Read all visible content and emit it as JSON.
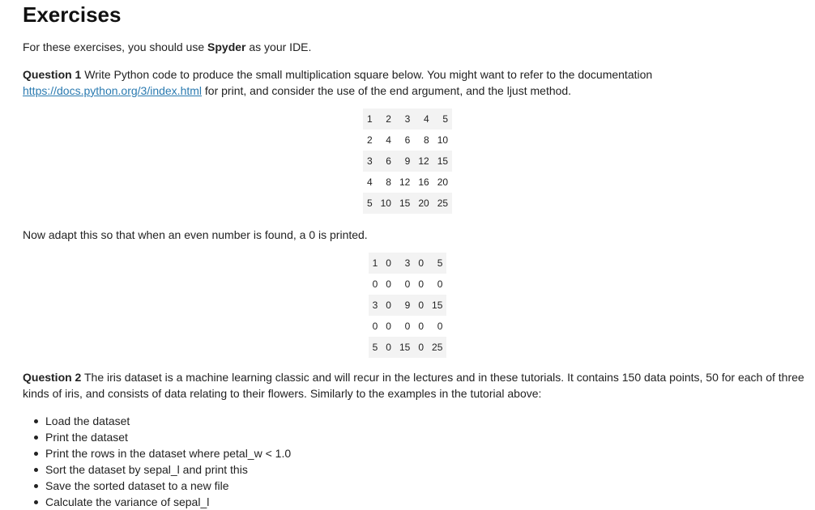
{
  "title": "Exercises",
  "intro": {
    "before": "For these exercises, you should use ",
    "ide": "Spyder",
    "after": " as your IDE."
  },
  "question1": {
    "label": "Question 1",
    "text_before": " Write Python code to produce the small multiplication square below. You might want to refer to the documentation ",
    "link_text": "https://docs.python.org/3/index.html",
    "text_after": " for print, and consider the use of the end argument, and the ljust method.",
    "table": [
      [
        "1",
        "2",
        "3",
        "4",
        "5"
      ],
      [
        "2",
        "4",
        "6",
        "8",
        "10"
      ],
      [
        "3",
        "6",
        "9",
        "12",
        "15"
      ],
      [
        "4",
        "8",
        "12",
        "16",
        "20"
      ],
      [
        "5",
        "10",
        "15",
        "20",
        "25"
      ]
    ]
  },
  "adapt": {
    "text": "Now adapt this so that when an even number is found, a 0 is printed.",
    "table": [
      [
        "1",
        "0",
        "3",
        "0",
        "5"
      ],
      [
        "0",
        "0",
        "0",
        "0",
        "0"
      ],
      [
        "3",
        "0",
        "9",
        "0",
        "15"
      ],
      [
        "0",
        "0",
        "0",
        "0",
        "0"
      ],
      [
        "5",
        "0",
        "15",
        "0",
        "25"
      ]
    ]
  },
  "question2": {
    "label": "Question 2",
    "text": " The iris dataset is a machine learning classic and will recur in the lectures and in these tutorials. It contains 150 data points, 50 for each of three kinds of iris, and consists of data relating to their flowers. Similarly to the examples in the tutorial above:",
    "tasks": [
      "Load the dataset",
      "Print the dataset",
      "Print the rows in the dataset where petal_w < 1.0",
      "Sort the dataset by sepal_l and print this",
      "Save the sorted dataset to a new file",
      "Calculate the variance of sepal_l"
    ]
  }
}
